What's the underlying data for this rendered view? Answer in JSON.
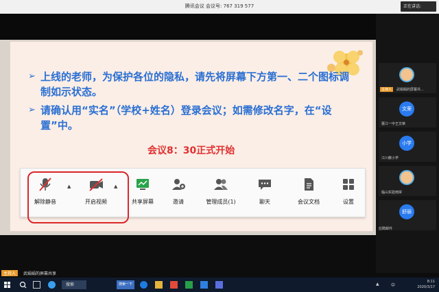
{
  "window": {
    "title": "腾讯会议  会议号: 767 319 577",
    "speaking_label": "正在讲话:"
  },
  "slide": {
    "bullets": [
      "上线的老师，为保护各位的隐私，请先将屏幕下方第一、二个图标调制如示状态。",
      "请确认用“实名”（学校+姓名）登录会议；如需修改名字，在“设置”中。"
    ],
    "start_notice": "会议8：30正式开始"
  },
  "toolbar": {
    "items": [
      {
        "label": "解除静音",
        "icon": "muted-mic-icon"
      },
      {
        "label": "开启视频",
        "icon": "video-off-icon"
      },
      {
        "label": "共享屏幕",
        "icon": "share-screen-icon"
      },
      {
        "label": "邀请",
        "icon": "invite-icon"
      },
      {
        "label": "管理成员(1)",
        "icon": "members-icon"
      },
      {
        "label": "聊天",
        "icon": "chat-icon"
      },
      {
        "label": "会议文档",
        "icon": "document-icon"
      },
      {
        "label": "设置",
        "icon": "settings-grid-icon"
      }
    ]
  },
  "participants": [
    {
      "name": "",
      "avatar_text": "",
      "badge": ""
    },
    {
      "name": "武娟娟的屏幕共...",
      "avatar_text": "",
      "badge": "主持人"
    },
    {
      "name": "蕾江一中王文荣",
      "avatar_text": "文荣",
      "badge": ""
    },
    {
      "name": "江川教小学",
      "avatar_text": "小学",
      "badge": ""
    },
    {
      "name": "临山实验南岸",
      "avatar_text": "",
      "badge": ""
    },
    {
      "name": "",
      "avatar_text": "舒丽",
      "badge": ""
    }
  ],
  "participant_tag": "应聘邮件",
  "sharebar": {
    "tag": "主持人",
    "text": "武娟娟的屏幕共享"
  },
  "taskbar": {
    "search_text": "搜索",
    "find_text": "搜索一下",
    "time": "8:11",
    "date": "2020/3/17",
    "lang": "中"
  },
  "colors": {
    "slide_text": "#2a6fd3",
    "notice": "#e03131",
    "highlight_box": "#d9262b",
    "avatar_blue": "#2a7bf0"
  }
}
